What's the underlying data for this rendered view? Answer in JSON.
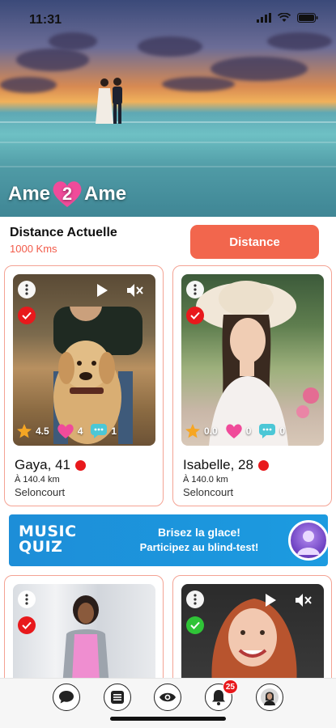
{
  "status_bar": {
    "time": "11:31",
    "icons": [
      "signal-icon",
      "wifi-icon",
      "battery-icon"
    ]
  },
  "brand": {
    "part1": "Ame",
    "part2": "2",
    "part3": "Ame"
  },
  "distance": {
    "title": "Distance Actuelle",
    "value": "1000 Kms",
    "button_label": "Distance"
  },
  "profiles": [
    {
      "name": "Gaya, 41",
      "distance": "À 140.4 km",
      "city": "Seloncourt",
      "rating": "4.5",
      "likes": "4",
      "messages": "1",
      "verified": true,
      "online": true
    },
    {
      "name": "Isabelle, 28",
      "distance": "À 140.0 km",
      "city": "Seloncourt",
      "rating": "0.0",
      "likes": "0",
      "messages": "0",
      "verified": true,
      "online": true
    },
    {
      "verified": true
    },
    {
      "verified": true
    }
  ],
  "banner": {
    "logo_line1": "MUSIC",
    "logo_line2": "QUIZ",
    "headline": "Brisez la glace!",
    "subline": "Participez au blind-test!"
  },
  "nav": {
    "items": [
      "chat-icon",
      "list-icon",
      "eye-icon",
      "bell-icon",
      "profile-icon"
    ],
    "notifications_badge": "25"
  },
  "colors": {
    "accent": "#f2664d",
    "card_border": "#f4a394",
    "verified_red": "#e8191c",
    "verified_green": "#2fc437",
    "heart": "#f04b9a",
    "star": "#f6a623",
    "chat": "#4cc7d6",
    "banner_blue": "#1c9be0"
  }
}
